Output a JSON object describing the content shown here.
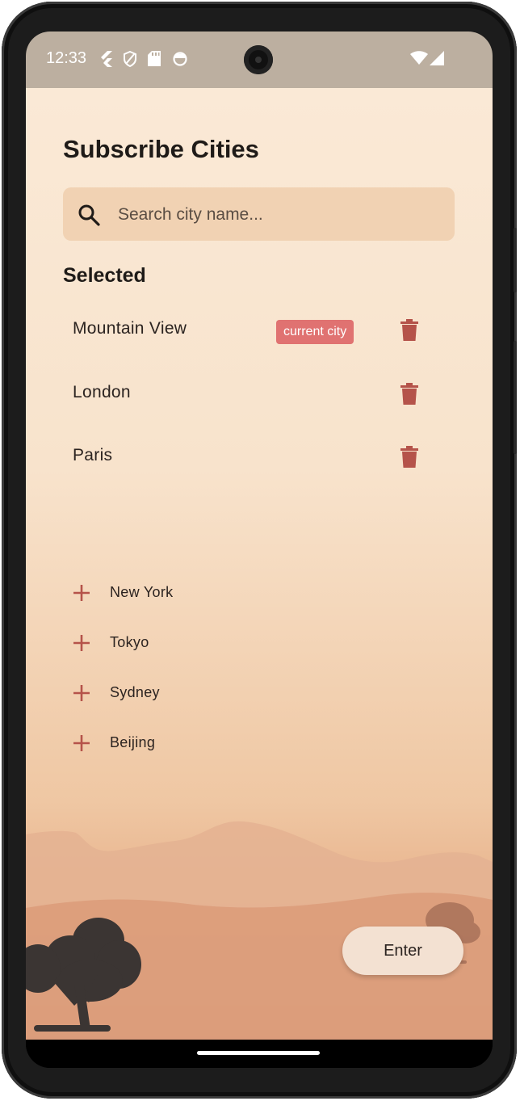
{
  "status_bar": {
    "time": "12:33",
    "icons": [
      "flutter-icon",
      "shield-icon",
      "sd-card-icon",
      "circle-status-icon",
      "wifi-icon",
      "signal-icon"
    ]
  },
  "page": {
    "title": "Subscribe Cities"
  },
  "search": {
    "placeholder": "Search city name...",
    "icon": "search-icon"
  },
  "selected": {
    "heading": "Selected",
    "cities": [
      {
        "name": "Mountain View",
        "badge": "current city"
      },
      {
        "name": "London"
      },
      {
        "name": "Paris"
      }
    ]
  },
  "available": {
    "cities": [
      "New York",
      "Tokyo",
      "Sydney",
      "Beijing"
    ]
  },
  "actions": {
    "enter_label": "Enter"
  },
  "colors": {
    "accent": "#b5534a",
    "badge": "#e07271",
    "search_bg": "#f1d2b3",
    "status_bar": "#bcafa0"
  }
}
